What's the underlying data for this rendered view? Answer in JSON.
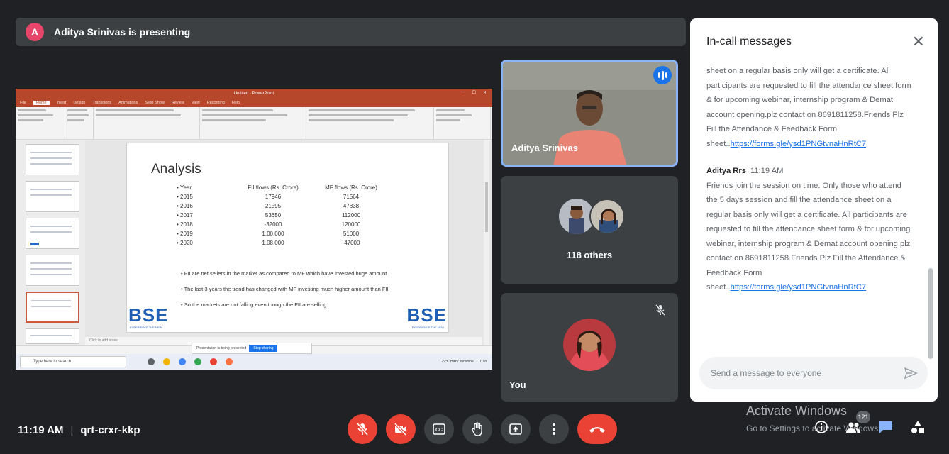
{
  "presenter": {
    "avatar_letter": "A",
    "text": "Aditya Srinivas is presenting"
  },
  "shared_screen": {
    "app_title": "Untitled - PowerPoint",
    "ribbon_tabs": [
      "File",
      "Home",
      "Insert",
      "Design",
      "Transitions",
      "Animations",
      "Slide Show",
      "Review",
      "View",
      "Recording",
      "Help"
    ],
    "slide": {
      "title": "Analysis",
      "table_header": [
        "• Year",
        "FII flows (Rs. Crore)",
        "MF flows (Rs. Crore)"
      ],
      "table_rows": [
        [
          "• 2015",
          "17946",
          "71564"
        ],
        [
          "• 2016",
          "21595",
          "47838"
        ],
        [
          "• 2017",
          "53650",
          "112000"
        ],
        [
          "• 2018",
          "-32000",
          "120000"
        ],
        [
          "• 2019",
          "1,00,000",
          "51000"
        ],
        [
          "• 2020",
          "1,08,000",
          "-47000"
        ]
      ],
      "bullets": [
        "FII are net sellers in the market as compared to MF which have invested huge amount",
        "The last 3 years the trend has changed with MF investing much higher amount than FII",
        "So the markets are not falling even though the FII are selling"
      ],
      "logo_text": "BSE",
      "logo_sub": "EXPERIENCE THE NEW"
    },
    "notes_placeholder": "Click to add notes",
    "toast_text": "Presentation is being presented",
    "toast_button": "Stop sharing",
    "taskbar_search": "Type here to search",
    "taskbar_clock": "11:18",
    "taskbar_weather": "29°C Hazy sunshine"
  },
  "tiles": {
    "active_name": "Aditya Srinivas",
    "others_label": "118 others",
    "you_label": "You"
  },
  "chat": {
    "title": "In-call messages",
    "message1_tail": "sheet on a regular basis only will get a certificate. All participants are requested to fill the attendance sheet form & for upcoming webinar, internship program & Demat account opening.plz contact on 8691811258.Friends Plz Fill the Attendance & Feedback Form sheet..",
    "link1": "https://forms.gle/ysd1PNGtvnaHnRtC7",
    "sender2": "Aditya Rrs",
    "time2": "11:19 AM",
    "message2": "Friends join the session on time. Only those who attend the 5 days session and fill the attendance sheet on a regular basis only will get a certificate. All participants are requested to fill the attendance sheet form & for upcoming webinar, internship program & Demat account opening.plz contact on 8691811258.Friends Plz Fill the Attendance & Feedback Form sheet..",
    "link2": "https://forms.gle/ysd1PNGtvnaHnRtC7",
    "input_placeholder": "Send a message to everyone"
  },
  "bottom": {
    "time": "11:19 AM",
    "separator": "|",
    "meeting_code": "qrt-crxr-kkp",
    "participants_count": "121",
    "watermark_title": "Activate Windows",
    "watermark_sub": "Go to Settings to activate Windows."
  },
  "colors": {
    "end_call": "#ea4335",
    "accent": "#1a73e8",
    "background": "#202124"
  }
}
